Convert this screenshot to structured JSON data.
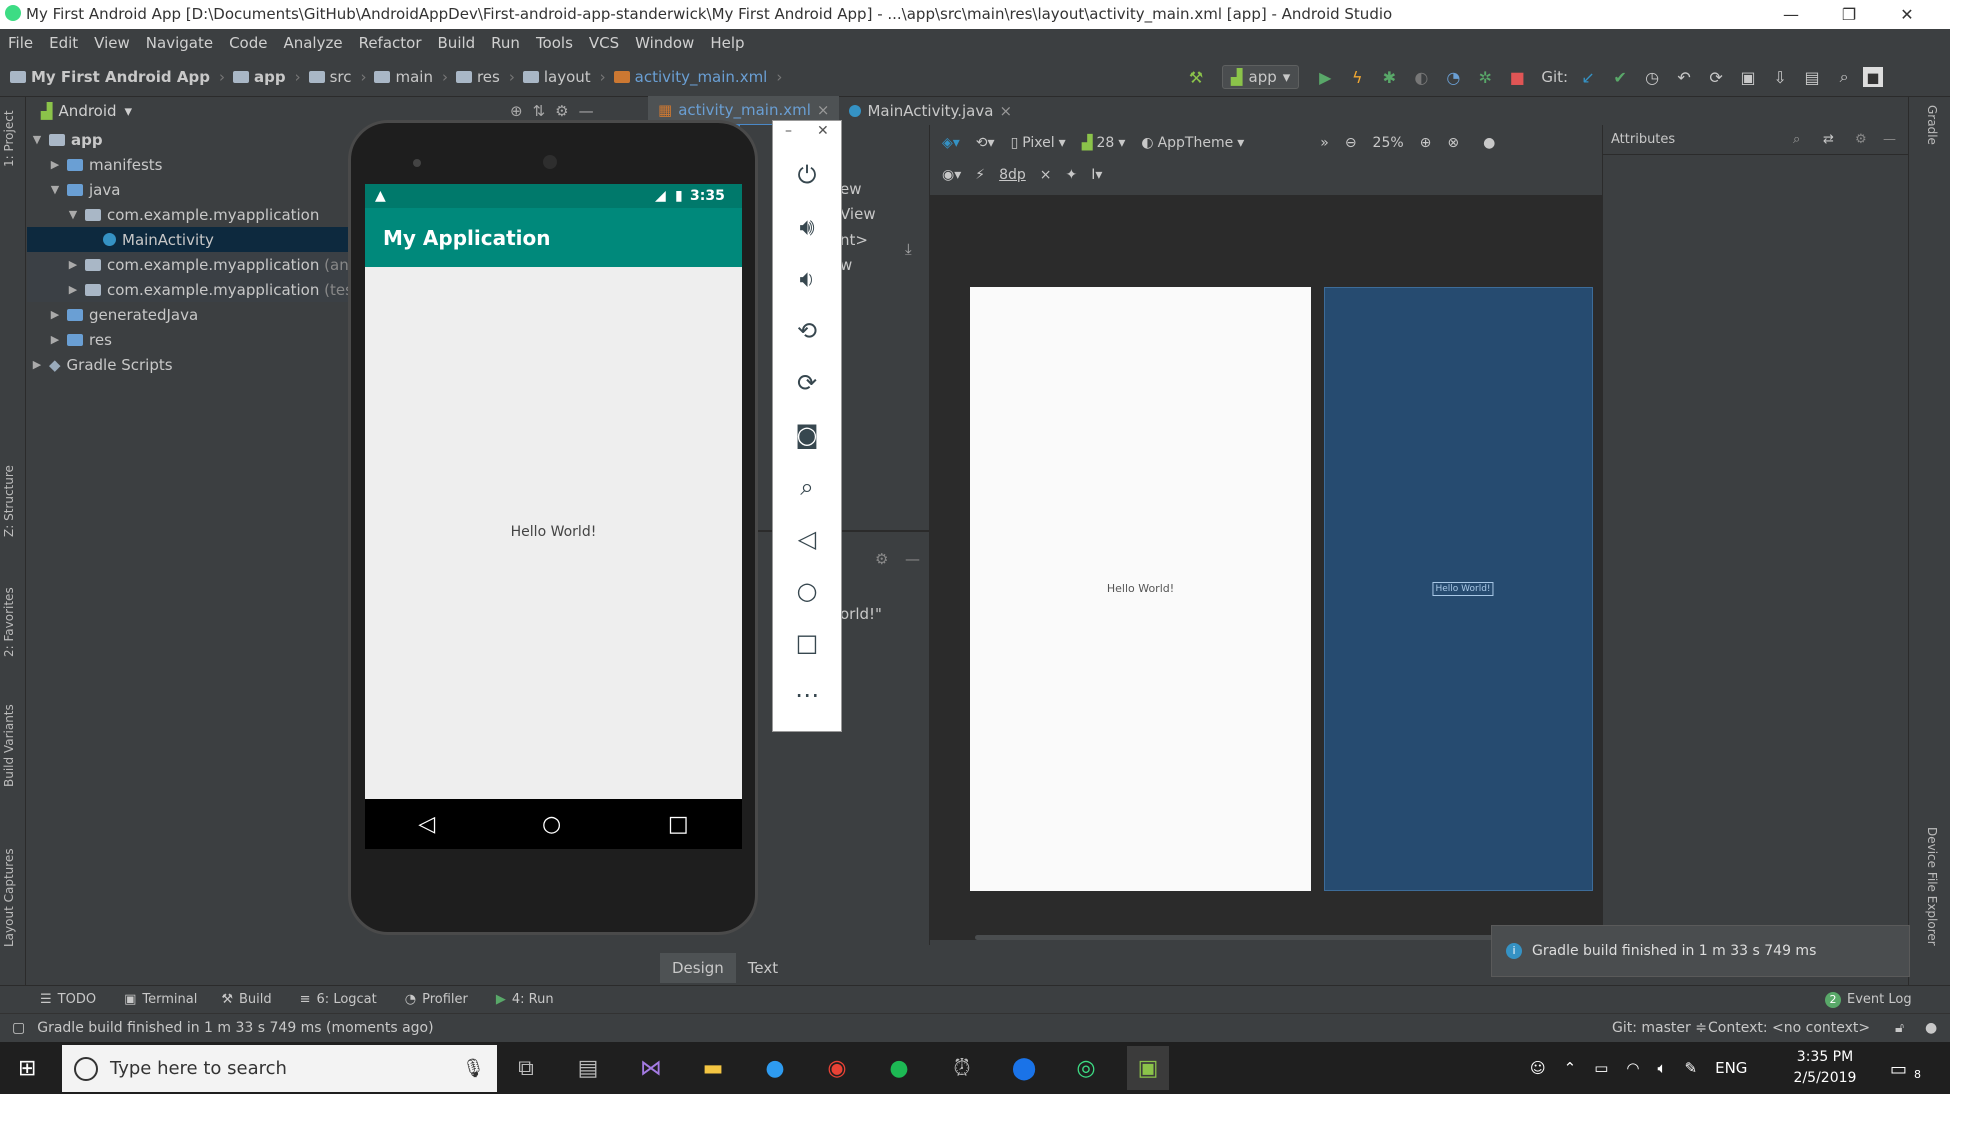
{
  "window": {
    "title": "My First Android App [D:\\Documents\\GitHub\\AndroidAppDev\\First-android-app-standerwick\\My First Android App] - ...\\app\\src\\main\\res\\layout\\activity_main.xml [app] - Android Studio",
    "minimize": "—",
    "restore": "❐",
    "close": "✕"
  },
  "menu": [
    "File",
    "Edit",
    "View",
    "Navigate",
    "Code",
    "Analyze",
    "Refactor",
    "Build",
    "Run",
    "Tools",
    "VCS",
    "Window",
    "Help"
  ],
  "breadcrumbs": [
    "My First Android App",
    "app",
    "src",
    "main",
    "res",
    "layout",
    "activity_main.xml"
  ],
  "toolbar": {
    "run_config": "app",
    "git_label": "Git:"
  },
  "project": {
    "view_selector": "Android",
    "tree": [
      {
        "label": "app",
        "level": 0,
        "expanded": true
      },
      {
        "label": "manifests",
        "level": 1,
        "expanded": false
      },
      {
        "label": "java",
        "level": 1,
        "expanded": true
      },
      {
        "label": "com.example.myapplication",
        "level": 2,
        "expanded": true
      },
      {
        "label": "MainActivity",
        "level": 3,
        "selected": true
      },
      {
        "label": "com.example.myapplication",
        "suffix": "(and",
        "level": 2,
        "expanded": false
      },
      {
        "label": "com.example.myapplication",
        "suffix": "(test",
        "level": 2,
        "expanded": false
      },
      {
        "label": "generatedJava",
        "level": 1,
        "expanded": false
      },
      {
        "label": "res",
        "level": 1,
        "expanded": false
      },
      {
        "label": "Gradle Scripts",
        "level": 0,
        "expanded": false
      }
    ]
  },
  "left_tool_windows": [
    "1: Project",
    "Z: Structure",
    "2: Favorites",
    "Build Variants",
    "Layout Captures"
  ],
  "right_tool_windows": [
    "Gradle",
    "Device File Explorer"
  ],
  "editor_tabs": [
    {
      "label": "activity_main.xml",
      "active": true
    },
    {
      "label": "MainActivity.java",
      "active": false
    }
  ],
  "design_toolbar": {
    "device": "Pixel",
    "api": "28",
    "theme": "AppTheme",
    "zoom": "25%",
    "margin": "8dp"
  },
  "palette_fragments": [
    "ew",
    "View",
    "nt>",
    "w"
  ],
  "component_tree_fragment": "orld!\"",
  "attributes_title": "Attributes",
  "canvas": {
    "design_text": "Hello World!",
    "blueprint_text": "Hello World!"
  },
  "bottom_editor_tabs": [
    "Design",
    "Text"
  ],
  "emulator": {
    "time": "3:35",
    "app_title": "My Application",
    "content": "Hello World!"
  },
  "notification": "Gradle build finished in 1 m 33 s 749 ms",
  "tool_tabs": [
    "TODO",
    "Terminal",
    "Build",
    "6: Logcat",
    "Profiler",
    "4: Run"
  ],
  "event_log": {
    "count": "2",
    "label": "Event Log"
  },
  "status": {
    "message": "Gradle build finished in 1 m 33 s 749 ms (moments ago)",
    "git": "Git: master ≑",
    "context": "Context: <no context>"
  },
  "taskbar": {
    "search_placeholder": "Type here to search",
    "lang": "ENG",
    "time": "3:35 PM",
    "date": "2/5/2019",
    "notifications": "8"
  }
}
